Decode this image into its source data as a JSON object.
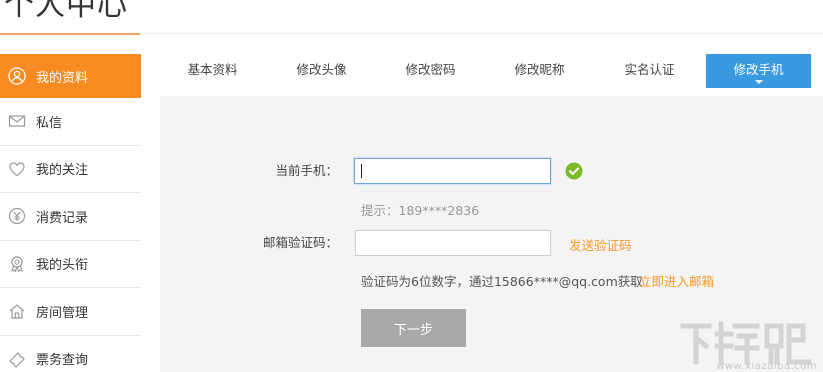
{
  "page": {
    "title": "个人中心"
  },
  "sidebar": {
    "items": [
      {
        "label": "我的资料",
        "icon": "user-icon",
        "active": true
      },
      {
        "label": "私信",
        "icon": "mail-icon",
        "active": false
      },
      {
        "label": "我的关注",
        "icon": "heart-icon",
        "active": false
      },
      {
        "label": "消费记录",
        "icon": "yen-icon",
        "active": false
      },
      {
        "label": "我的头衔",
        "icon": "medal-icon",
        "active": false
      },
      {
        "label": "房间管理",
        "icon": "house-icon",
        "active": false
      },
      {
        "label": "票务查询",
        "icon": "ticket-icon",
        "active": false
      }
    ]
  },
  "tabs": [
    {
      "label": "基本资料",
      "active": false
    },
    {
      "label": "修改头像",
      "active": false
    },
    {
      "label": "修改密码",
      "active": false
    },
    {
      "label": "修改昵称",
      "active": false
    },
    {
      "label": "实名认证",
      "active": false
    },
    {
      "label": "修改手机",
      "active": true
    }
  ],
  "form": {
    "phone_label": "当前手机：",
    "phone_value": "",
    "phone_hint": "提示：189****2836",
    "code_label": "邮箱验证码：",
    "code_value": "",
    "send_code_link": "发送验证码",
    "code_hint": "验证码为6位数字，通过15866****@qq.com获取",
    "enter_mailbox_link": "立即进入邮箱",
    "next_button": "下一步"
  },
  "watermark": {
    "text": "www.xiazaiba.com",
    "logo_text": "下载吧"
  },
  "colors": {
    "accent_orange": "#f78b21",
    "tab_blue": "#3a9ae0",
    "check_green": "#7cba2a",
    "link_orange": "#f39a2b"
  }
}
